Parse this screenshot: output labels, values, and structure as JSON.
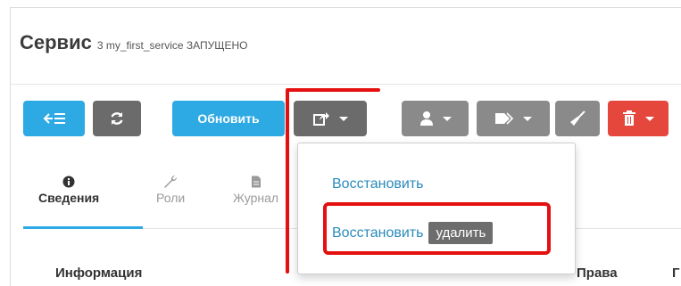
{
  "header": {
    "title": "Сервис",
    "subtitle": "3 my_first_service ЗАПУЩЕНО"
  },
  "toolbar": {
    "update_label": "Обновить"
  },
  "tabs": [
    {
      "label": "Сведения",
      "icon": "info-icon",
      "active": true
    },
    {
      "label": "Роли",
      "icon": "wrench-icon",
      "active": false
    },
    {
      "label": "Журнал",
      "icon": "file-icon",
      "active": false
    }
  ],
  "dropdown": {
    "item1": "Восстановить",
    "item2": "Восстановить",
    "item2_badge": "удалить"
  },
  "content": {
    "info_label": "Информация",
    "rights_label": "Права",
    "partial_label": "Г"
  },
  "colors": {
    "accent_blue": "#2da9e4",
    "dark_grey": "#6b6b6b",
    "danger_red": "#e5473c",
    "highlight_red": "#e40f0f"
  }
}
